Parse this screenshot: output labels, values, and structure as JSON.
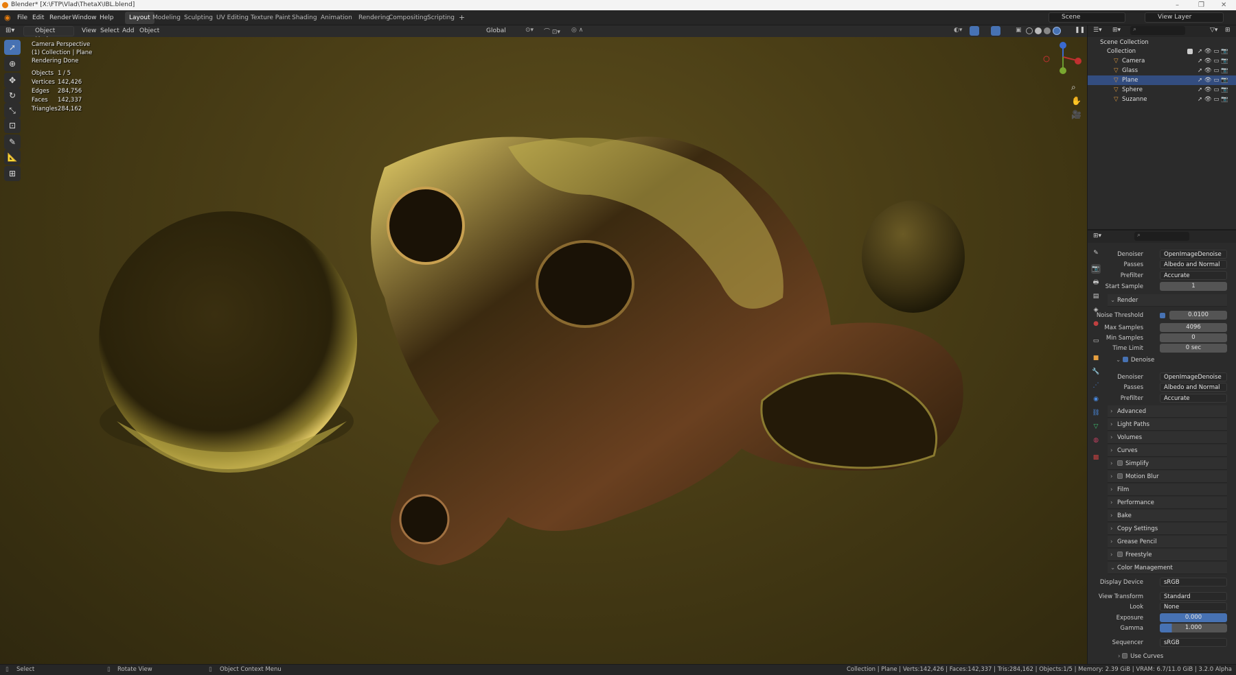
{
  "window": {
    "title": "Blender* [X:\\FTP\\Vlad\\ThetaX\\IBL.blend]",
    "controls": [
      "–",
      "❐",
      "✕"
    ]
  },
  "menubar": {
    "items": [
      "File",
      "Edit",
      "Render",
      "Window",
      "Help"
    ]
  },
  "workspaces": [
    "Layout",
    "Modeling",
    "Sculpting",
    "UV Editing",
    "Texture Paint",
    "Shading",
    "Animation",
    "Rendering",
    "Compositing",
    "Scripting",
    "+"
  ],
  "scene": {
    "name": "Scene",
    "view_layer": "View Layer"
  },
  "header": {
    "mode": "Object Mode",
    "menus": [
      "View",
      "Select",
      "Add",
      "Object"
    ],
    "transform": "Global"
  },
  "overlay": {
    "line1": "Camera Perspective",
    "line2": "(1) Collection | Plane",
    "line3": "Rendering Done",
    "stats": [
      {
        "k": "Objects",
        "v": "1 / 5"
      },
      {
        "k": "Vertices",
        "v": "142,426"
      },
      {
        "k": "Edges",
        "v": "284,756"
      },
      {
        "k": "Faces",
        "v": "142,337"
      },
      {
        "k": "Triangles",
        "v": "284,162"
      }
    ]
  },
  "outliner": {
    "root": "Scene Collection",
    "collection": "Collection",
    "objects": [
      "Camera",
      "Glass",
      "Plane",
      "Sphere",
      "Suzanne"
    ],
    "selected": "Plane"
  },
  "props": {
    "top": [
      {
        "k": "Denoiser",
        "v": "OpenImageDenoise"
      },
      {
        "k": "Passes",
        "v": "Albedo and Normal"
      },
      {
        "k": "Prefilter",
        "v": "Accurate"
      },
      {
        "k": "Start Sample",
        "v": "1"
      }
    ],
    "render_title": "Render",
    "render": [
      {
        "k": "Noise Threshold",
        "v": "0.0100"
      },
      {
        "k": "Max Samples",
        "v": "4096"
      },
      {
        "k": "Min Samples",
        "v": "0"
      },
      {
        "k": "Time Limit",
        "v": "0 sec"
      }
    ],
    "denoise_title": "Denoise",
    "denoise": [
      {
        "k": "Denoiser",
        "v": "OpenImageDenoise"
      },
      {
        "k": "Passes",
        "v": "Albedo and Normal"
      },
      {
        "k": "Prefilter",
        "v": "Accurate"
      }
    ],
    "advanced": "Advanced",
    "sections": [
      "Light Paths",
      "Volumes",
      "Curves",
      "Simplify",
      "Motion Blur",
      "Film",
      "Performance",
      "Bake",
      "Copy Settings",
      "Grease Pencil",
      "Freestyle",
      "Color Management"
    ],
    "cm": [
      {
        "k": "Display Device",
        "v": "sRGB"
      },
      {
        "k": "View Transform",
        "v": "Standard"
      },
      {
        "k": "Look",
        "v": "None"
      },
      {
        "k": "Exposure",
        "v": "0.000"
      },
      {
        "k": "Gamma",
        "v": "1.000"
      },
      {
        "k": "Sequencer",
        "v": "sRGB"
      }
    ],
    "use_curves": "Use Curves"
  },
  "status": {
    "left": "Select",
    "mid": "Rotate View",
    "ctx": "Object Context Menu",
    "right": "Collection | Plane | Verts:142,426 | Faces:142,337 | Tris:284,162 | Objects:1/5 | Memory: 2.39 GiB | VRAM: 6.7/11.0 GiB | 3.2.0 Alpha"
  },
  "colors": {
    "accent": "#4772b3",
    "viewport": "#4a3e16",
    "panel": "#2b2b2b"
  }
}
